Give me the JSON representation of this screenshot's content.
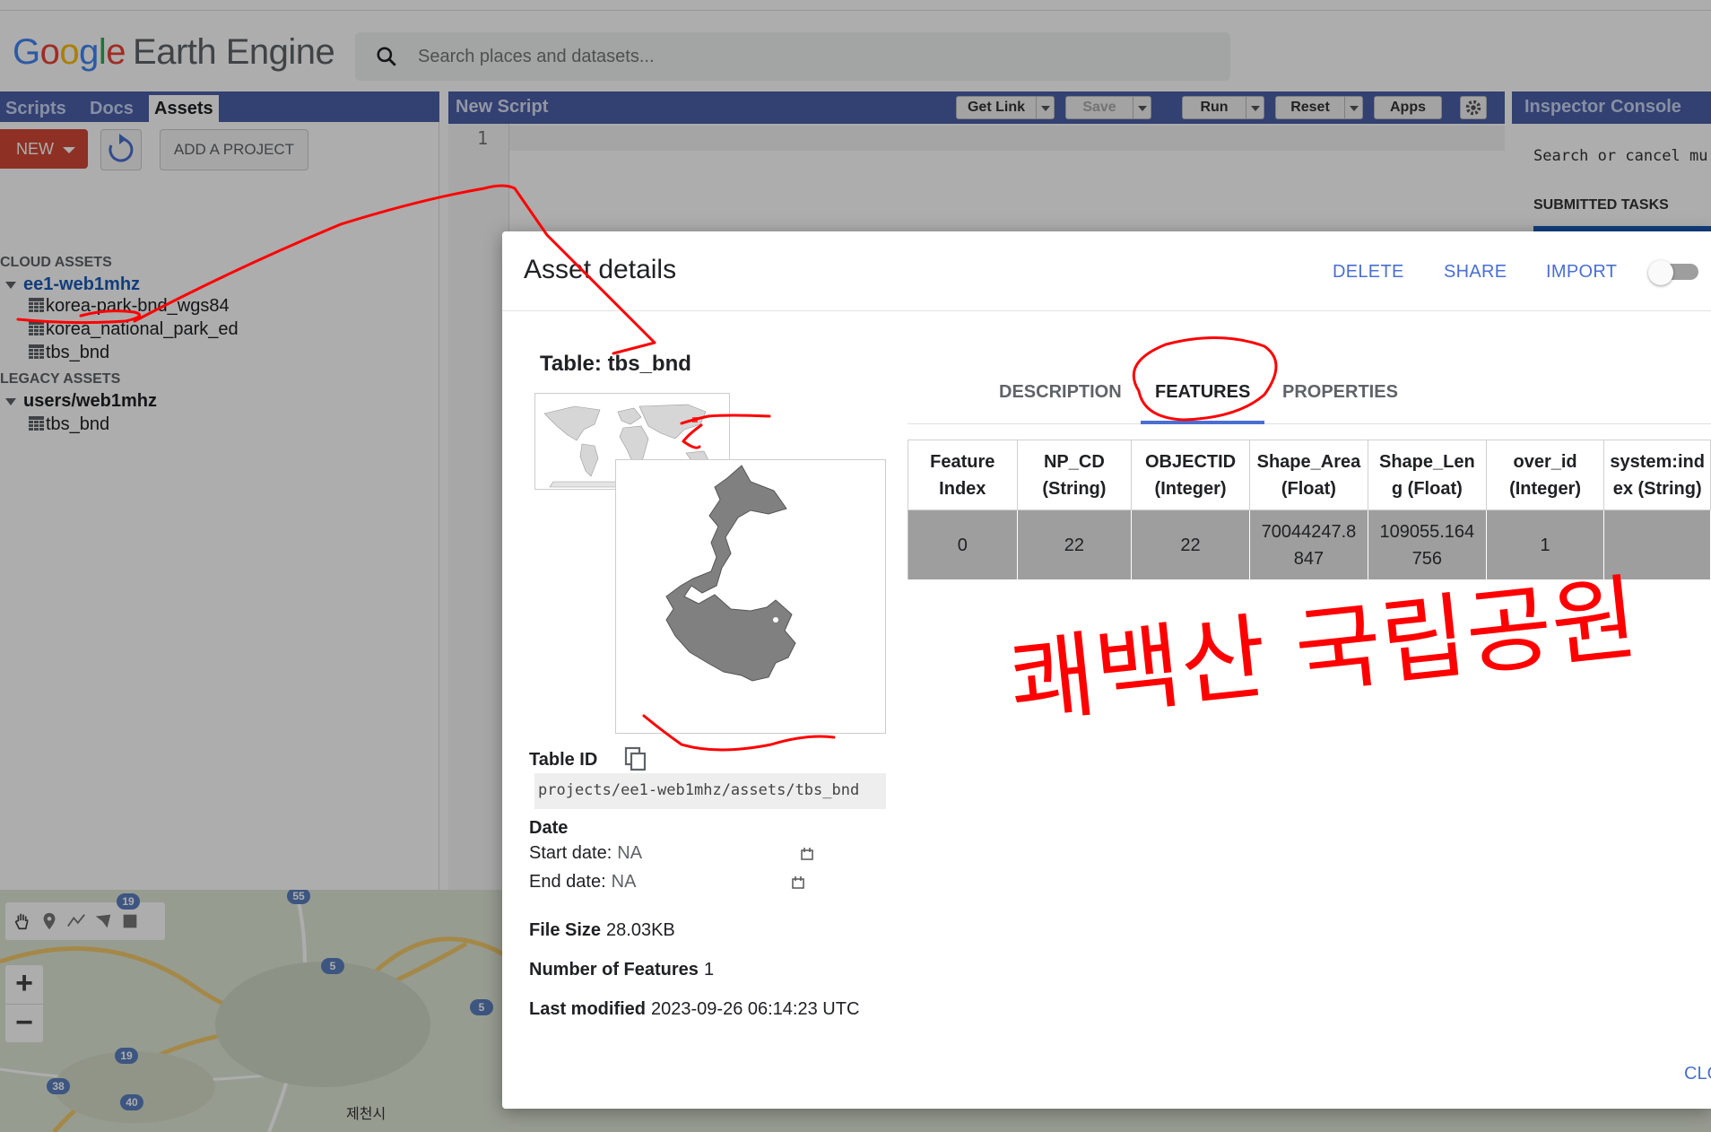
{
  "header": {
    "logo_letters": [
      "G",
      "o",
      "o",
      "g",
      "l",
      "e"
    ],
    "logo_suffix": "Earth Engine",
    "search_placeholder": "Search places and datasets..."
  },
  "left_panel": {
    "tabs": [
      "Scripts",
      "Docs",
      "Assets"
    ],
    "active_tab": "Assets",
    "new_label": "NEW",
    "add_project_label": "ADD A PROJECT",
    "cloud_section": "CLOUD ASSETS",
    "cloud_project": "ee1-web1mhz",
    "cloud_assets": [
      "korea-park-bnd_wgs84",
      "korea_national_park_ed",
      "tbs_bnd"
    ],
    "legacy_section": "LEGACY ASSETS",
    "legacy_user": "users/web1mhz",
    "legacy_assets": [
      "tbs_bnd"
    ]
  },
  "editor": {
    "title": "New Script",
    "buttons": {
      "get_link": "Get Link",
      "save": "Save",
      "run": "Run",
      "reset": "Reset",
      "apps": "Apps"
    },
    "line_number": "1"
  },
  "right_panel": {
    "tabs": [
      "Inspector",
      "Console"
    ],
    "search_text": "Search or cancel mu",
    "submitted": "SUBMITTED TASKS"
  },
  "map": {
    "road_badges": [
      "19",
      "55",
      "5",
      "5",
      "19",
      "38",
      "40"
    ],
    "city": "제천시"
  },
  "dialog": {
    "title": "Asset details",
    "actions": {
      "delete": "DELETE",
      "share": "SHARE",
      "import": "IMPORT"
    },
    "table_title": "Table: tbs_bnd",
    "table_id_label": "Table ID",
    "table_id": "projects/ee1-web1mhz/assets/tbs_bnd",
    "date_label": "Date",
    "start_label": "Start date:",
    "start_value": "NA",
    "end_label": "End date:",
    "end_value": "NA",
    "file_size_label": "File Size",
    "file_size": "28.03KB",
    "features_label": "Number of Features",
    "features_count": "1",
    "modified_label": "Last modified",
    "modified_value": "2023-09-26 06:14:23 UTC",
    "tabs": [
      "DESCRIPTION",
      "FEATURES",
      "PROPERTIES"
    ],
    "active_tab": "FEATURES",
    "close_label": "CLOSE"
  },
  "features_table": {
    "columns": [
      [
        "Feature",
        "Index"
      ],
      [
        "NP_CD",
        "(String)"
      ],
      [
        "OBJECTID",
        "(Integer)"
      ],
      [
        "Shape_Area",
        "(Float)"
      ],
      [
        "Shape_Len",
        "g (Float)"
      ],
      [
        "over_id",
        "(Integer)"
      ],
      [
        "system:ind",
        "ex (String)"
      ]
    ],
    "rows": [
      [
        [
          "0"
        ],
        [
          "22"
        ],
        [
          "22"
        ],
        [
          "70044247.8",
          "847"
        ],
        [
          "109055.164",
          "756"
        ],
        [
          "1"
        ],
        [
          ""
        ]
      ]
    ]
  },
  "handwriting": {
    "text": "쾌백산 국립공원",
    "color": "#ff0000"
  },
  "colors": {
    "panel_blue": "#4a5fa8",
    "link_blue": "#4a6fd1",
    "new_red": "#d14836",
    "annotation_red": "#ff0000"
  }
}
